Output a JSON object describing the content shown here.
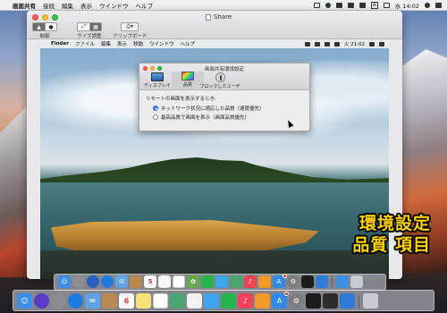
{
  "menubar": {
    "items": [
      "画面共有",
      "接続",
      "編集",
      "表示",
      "ウインドウ",
      "ヘルプ"
    ],
    "input_badge": "A",
    "clock": "水 14:02"
  },
  "window": {
    "title": "Share",
    "toolbar": {
      "control_label": "制御",
      "scale_label": "サイズ調整",
      "clipboard_label": "クリップボード"
    }
  },
  "remote_menubar": {
    "items": [
      "Finder",
      "ファイル",
      "編集",
      "表示",
      "移動",
      "ウインドウ",
      "ヘルプ"
    ],
    "clock": "火 21:02"
  },
  "prefs": {
    "title": "画面共有環境設定",
    "tabs": [
      "ディスプレイ",
      "品質",
      "ブロックしたユーザ"
    ],
    "active_tab": 1,
    "heading": "リモートの画面を表示するとき:",
    "options": [
      "ネットワーク状況に適応した品質（速度優先）",
      "最高品質で画面を表示（画面品質優先）"
    ],
    "selected_option": 0
  },
  "caption": {
    "line1": "環境設定",
    "line2": "品質 項目"
  },
  "colors": {
    "caption": "#ffd400",
    "selected_radio": "#3b82f0"
  },
  "dock_inner": {
    "icons": [
      "finder-icon",
      "launchpad-icon",
      "rocket-icon",
      "safari-icon",
      "mail-icon",
      "notes-icon",
      "calendar-icon",
      "reminders-icon",
      "list-icon",
      "photos-icon",
      "facetime-icon",
      "messages-icon",
      "maps-icon",
      "music-icon",
      "books-icon",
      "app-store-icon",
      "system-preferences-icon",
      "terminal-icon",
      "screen-sharing-icon",
      "downloads-icon",
      "trash-icon"
    ],
    "calendar_day": "5"
  },
  "dock_outer": {
    "icons": [
      "finder-icon",
      "siri-icon",
      "launchpad-icon",
      "safari-icon",
      "mail-icon",
      "contacts-icon",
      "calendar-icon",
      "notes-icon",
      "reminders-icon",
      "maps-icon",
      "photos-icon",
      "messages-icon",
      "facetime-icon",
      "music-icon",
      "books-icon",
      "app-store-icon",
      "system-preferences-icon",
      "terminal-icon",
      "activity-monitor-icon",
      "screen-sharing-icon",
      "trash-icon"
    ],
    "calendar_day": "6"
  }
}
